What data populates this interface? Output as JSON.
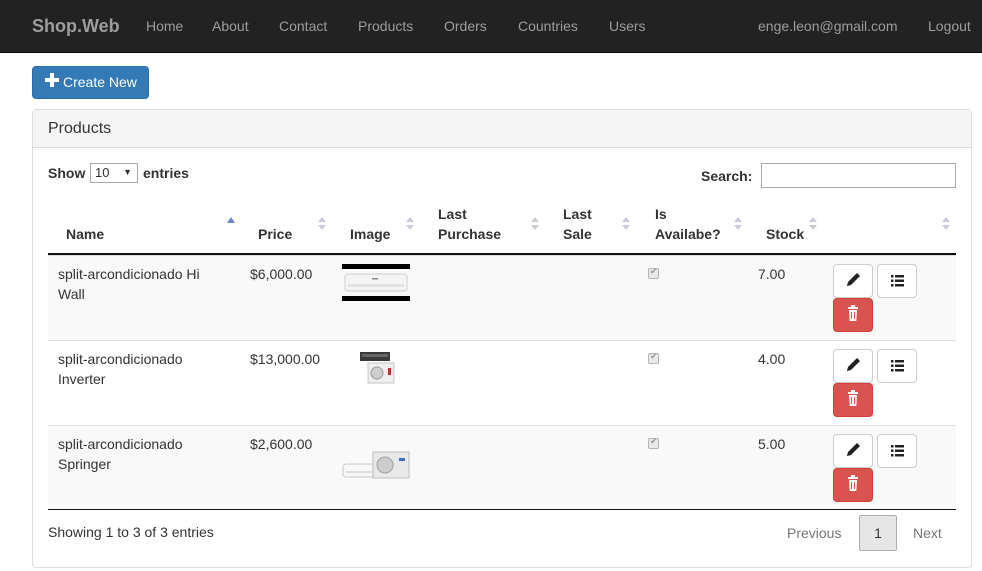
{
  "navbar": {
    "brand": "Shop.Web",
    "items": [
      "Home",
      "About",
      "Contact",
      "Products",
      "Orders",
      "Countries",
      "Users"
    ],
    "user_email": "enge.leon@gmail.com",
    "logout": "Logout"
  },
  "toolbar": {
    "create_label": "Create New"
  },
  "panel": {
    "title": "Products"
  },
  "length_menu": {
    "show": "Show",
    "selected": "10",
    "entries": "entries"
  },
  "search": {
    "label": "Search:",
    "value": ""
  },
  "table": {
    "columns": {
      "name": "Name",
      "price": "Price",
      "image": "Image",
      "last_purchase_1": "Last",
      "last_purchase_2": "Purchase",
      "last_sale_1": "Last",
      "last_sale_2": "Sale",
      "available_1": "Is",
      "available_2": "Availabe?",
      "stock": "Stock"
    },
    "sorted_column": "name",
    "rows": [
      {
        "name_1": "split-arcondicionado Hi",
        "name_2": "Wall",
        "price": "$6,000.00",
        "last_purchase": "",
        "last_sale": "",
        "available": true,
        "stock": "7.00",
        "image": "wall-ac-unit"
      },
      {
        "name_1": "split-arcondicionado",
        "name_2": "Inverter",
        "price": "$13,000.00",
        "last_purchase": "",
        "last_sale": "",
        "available": true,
        "stock": "4.00",
        "image": "inverter-ac-units"
      },
      {
        "name_1": "split-arcondicionado",
        "name_2": "Springer",
        "price": "$2,600.00",
        "last_purchase": "",
        "last_sale": "",
        "available": true,
        "stock": "5.00",
        "image": "split-ac-set"
      }
    ]
  },
  "footer": {
    "info": "Showing 1 to 3 of 3 entries",
    "previous": "Previous",
    "current_page": "1",
    "next": "Next"
  },
  "colors": {
    "navbar_bg": "#222222",
    "primary": "#337ab7",
    "danger": "#d9534f",
    "sort_active": "#6b85d9"
  },
  "icons": [
    "plus-icon",
    "pencil-icon",
    "list-icon",
    "trash-icon",
    "sort-icon",
    "checkbox-checked"
  ]
}
